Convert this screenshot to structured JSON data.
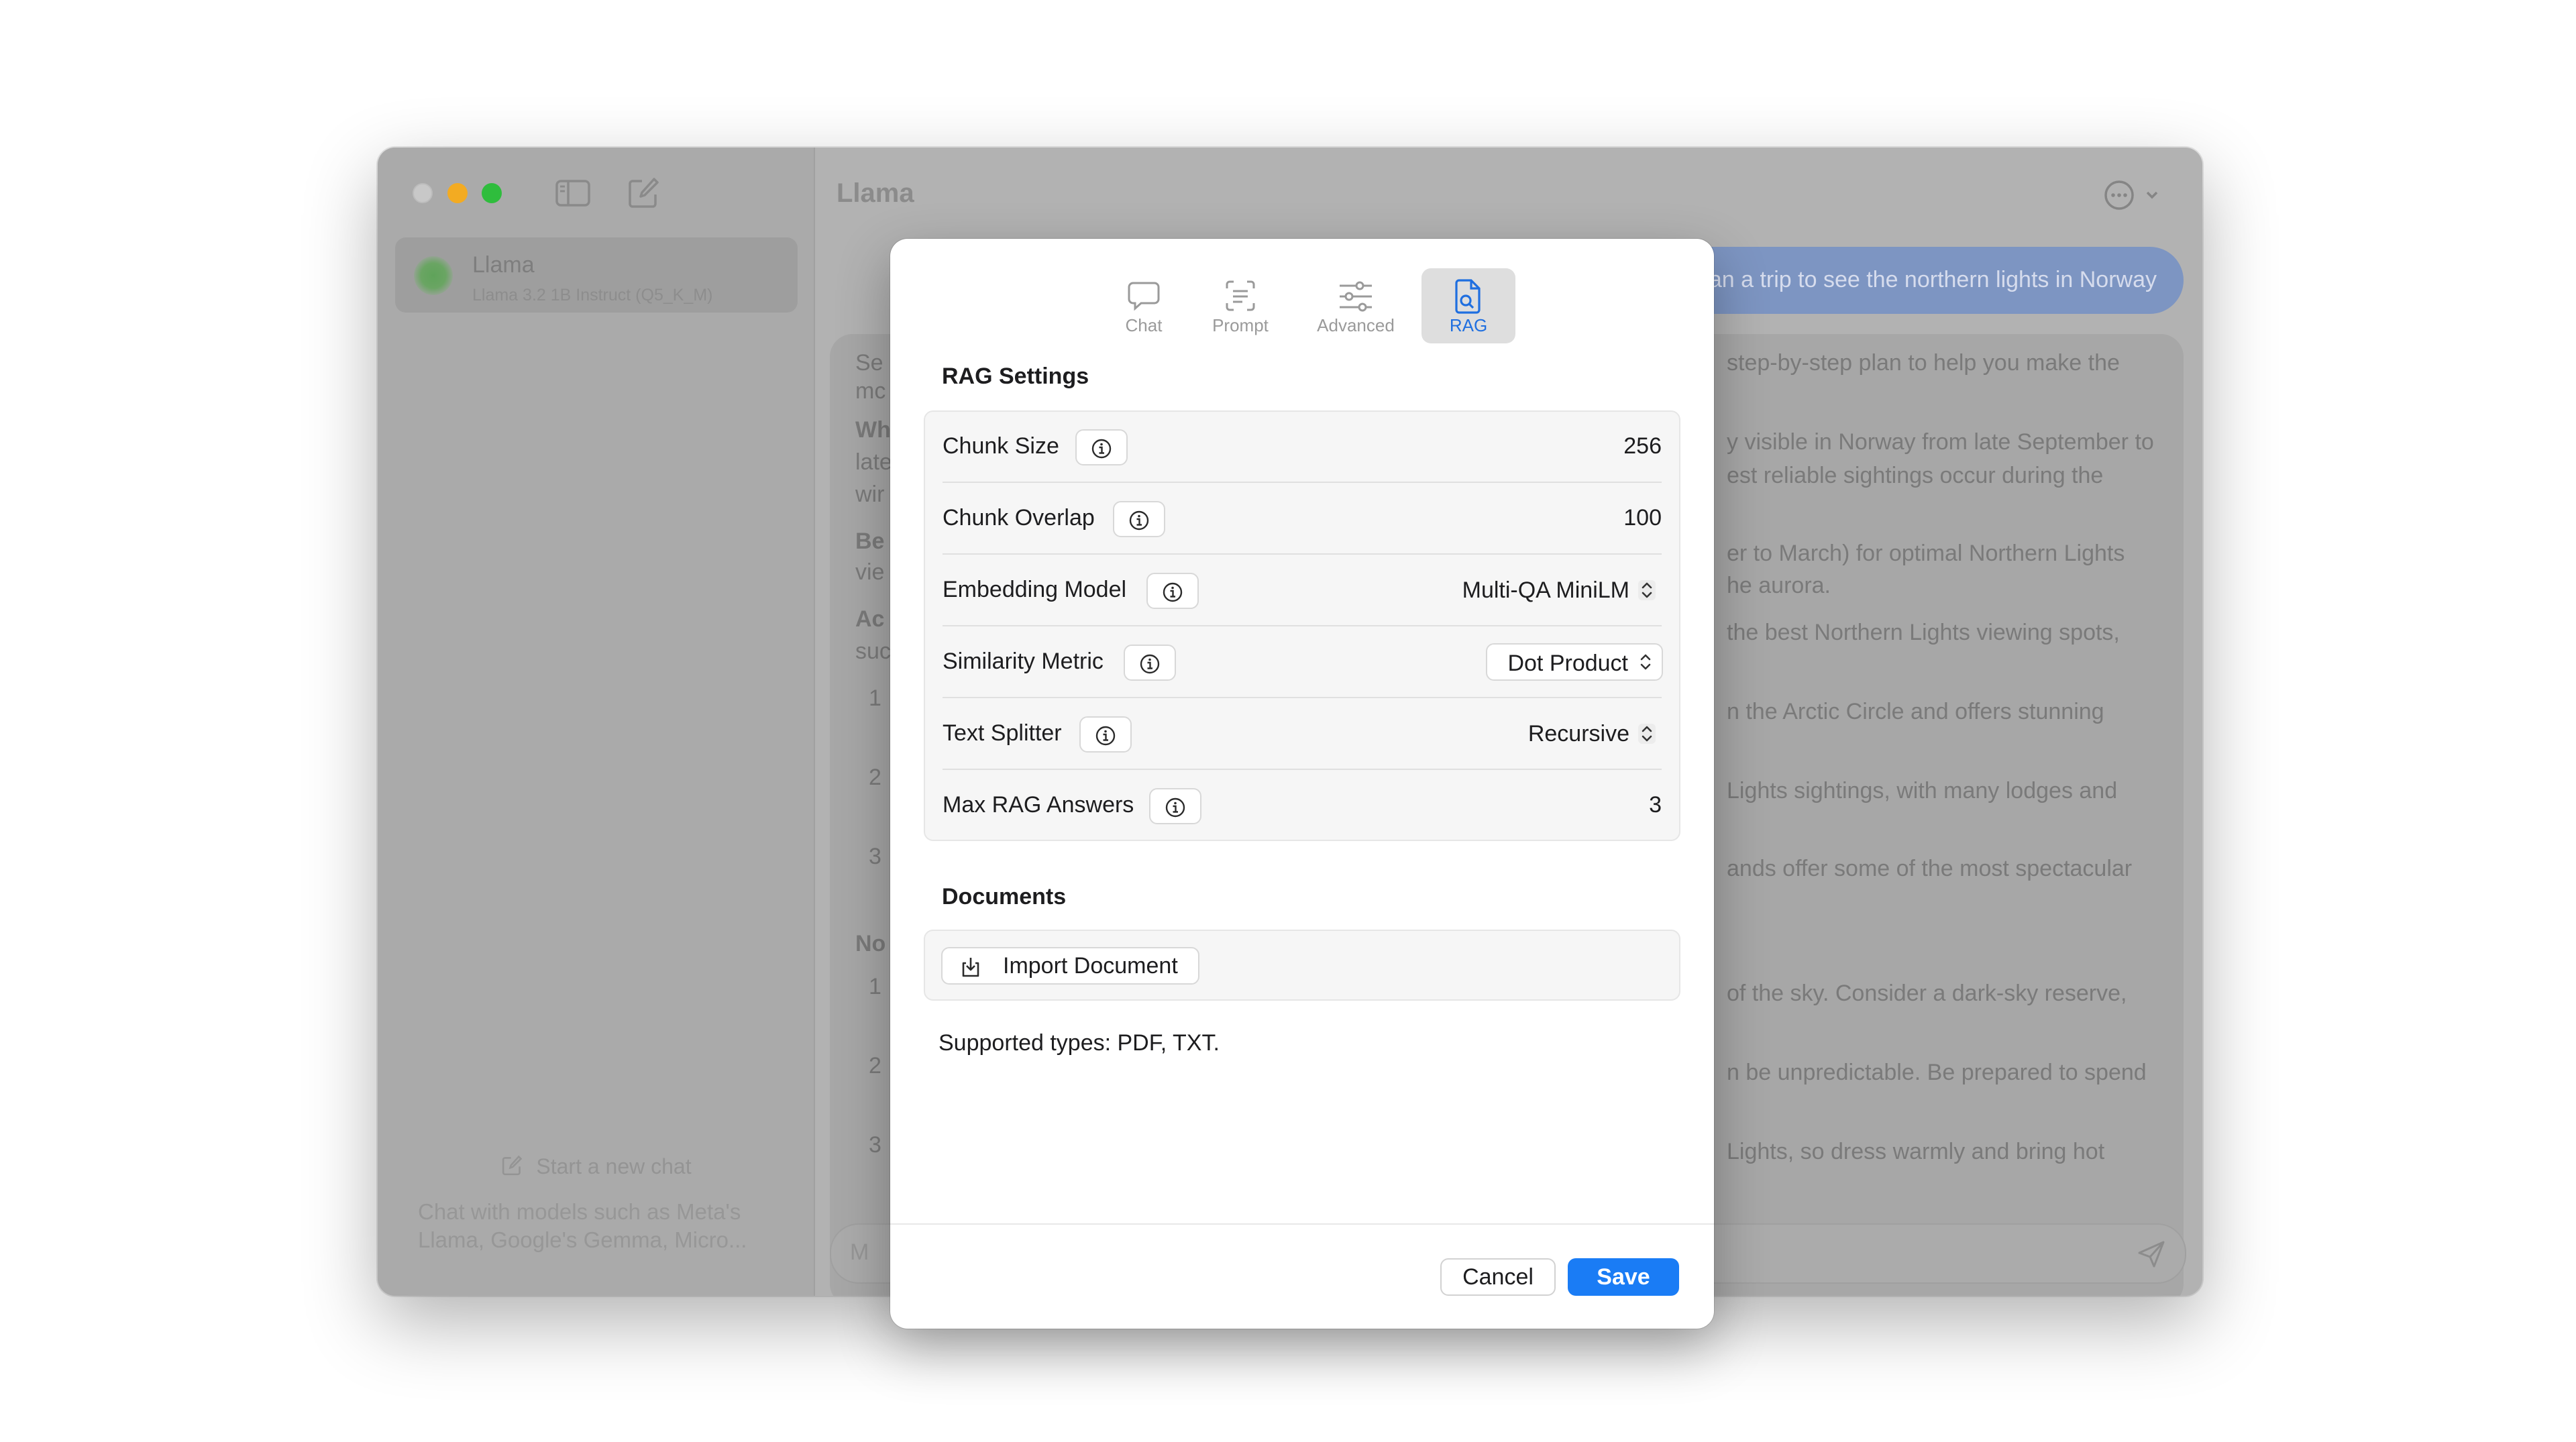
{
  "sidebar": {
    "model_name": "Llama",
    "model_subtitle": "Llama 3.2 1B Instruct (Q5_K_M)",
    "new_chat_label": "Start a new chat",
    "new_chat_description_line1": "Chat with models such as Meta's",
    "new_chat_description_line2": "Llama, Google's Gemma, Micro..."
  },
  "main": {
    "title": "Llama",
    "user_message": "an a trip to see the northern lights in Norway",
    "assistant_fragments_left": [
      "Se",
      "mc",
      "Wh",
      "late",
      "wir",
      "Be",
      "vie",
      "Ac",
      "suc",
      "1",
      "2",
      "3",
      "No",
      "1",
      "2",
      "3"
    ],
    "assistant_fragments_right": [
      "step-by-step plan to help you make the",
      "y visible in Norway from late September to",
      "est reliable sightings occur during the",
      "er to March) for optimal Northern Lights",
      "he aurora.",
      "the best Northern Lights viewing spots,",
      "n the Arctic Circle and offers stunning",
      "Lights sightings, with many lodges and",
      "ands offer some of the most spectacular",
      "of the sky. Consider a dark-sky reserve,",
      "n be unpredictable. Be prepared to spend",
      "Lights, so dress warmly and bring hot"
    ],
    "composer_placeholder": "M"
  },
  "dialog": {
    "tabs": [
      {
        "label": "Chat",
        "icon": "chat-bubble-icon"
      },
      {
        "label": "Prompt",
        "icon": "prompt-icon"
      },
      {
        "label": "Advanced",
        "icon": "sliders-icon"
      },
      {
        "label": "RAG",
        "icon": "document-search-icon"
      }
    ],
    "active_tab": "RAG",
    "rag_settings_title": "RAG Settings",
    "rows": {
      "chunk_size": {
        "label": "Chunk Size",
        "value": "256"
      },
      "chunk_overlap": {
        "label": "Chunk Overlap",
        "value": "100"
      },
      "embedding_model": {
        "label": "Embedding Model",
        "value": "Multi-QA MiniLM"
      },
      "similarity_metric": {
        "label": "Similarity Metric",
        "value": "Dot Product"
      },
      "text_splitter": {
        "label": "Text Splitter",
        "value": "Recursive"
      },
      "max_rag_answers": {
        "label": "Max RAG Answers",
        "value": "3"
      }
    },
    "documents_title": "Documents",
    "import_button": "Import Document",
    "supported_types": "Supported types: PDF, TXT.",
    "cancel_label": "Cancel",
    "save_label": "Save"
  },
  "colors": {
    "accent": "#1a7cf5",
    "active_tab_bg": "#dedede",
    "traffic_minimize": "#f3ab22",
    "traffic_maximize": "#2fbd3d"
  }
}
